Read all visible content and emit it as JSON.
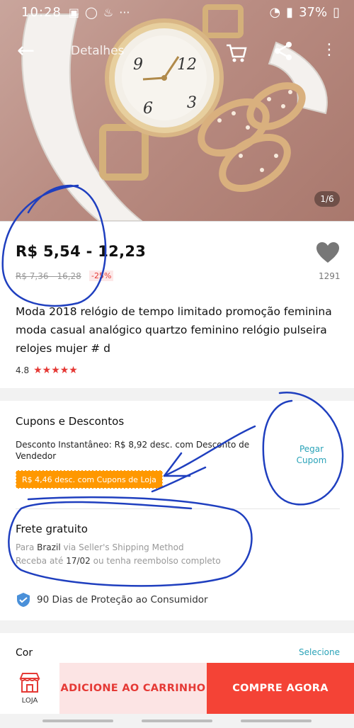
{
  "status_bar": {
    "time": "10:28",
    "battery": "37%",
    "more_glyph": "···"
  },
  "app_bar": {
    "title": "Detalhes",
    "more_glyph": "⋮",
    "back_glyph": "←"
  },
  "gallery": {
    "counter": "1/6"
  },
  "price": {
    "current": "R$ 5,54 - 12,23",
    "original": "R$ 7,36 - 16,28",
    "discount": "-25%",
    "wishlist_count": "1291"
  },
  "product": {
    "title": "Moda 2018 relógio de tempo limitado promoção feminina moda casual analógico quartzo feminino relógio pulseira relojes mujer # d",
    "rating": "4.8",
    "stars": "★★★★★"
  },
  "coupons": {
    "section_title": "Cupons e Descontos",
    "instant_discount": "Desconto Instantâneo: R$ 8,92 desc. com Desconto de Vendedor",
    "store_coupon": "R$ 4,46 desc. com Cupons de Loja",
    "get_coupon": "Pegar Cupom"
  },
  "shipping": {
    "title": "Frete gratuito",
    "line1_prefix": "Para",
    "line1_country": "Brazil",
    "line1_suffix": "via Seller's Shipping Method",
    "line2_prefix": "Receba até",
    "line2_date": "17/02",
    "line2_suffix": "ou tenha reembolso completo"
  },
  "protection": {
    "text": "90 Dias de Proteção ao Consumidor"
  },
  "color": {
    "label": "Cor",
    "select": "Selecione"
  },
  "bottom_bar": {
    "store_label": "LOJA",
    "add_to_cart": "ADICIONE AO CARRINHO",
    "buy_now": "COMPRE AGORA"
  },
  "colors": {
    "accent_red": "#f44336",
    "discount_red": "#e53935",
    "coupon_orange": "#ff9800",
    "link_teal": "#2aa3b8",
    "annotation_blue": "#1f3fbf"
  }
}
